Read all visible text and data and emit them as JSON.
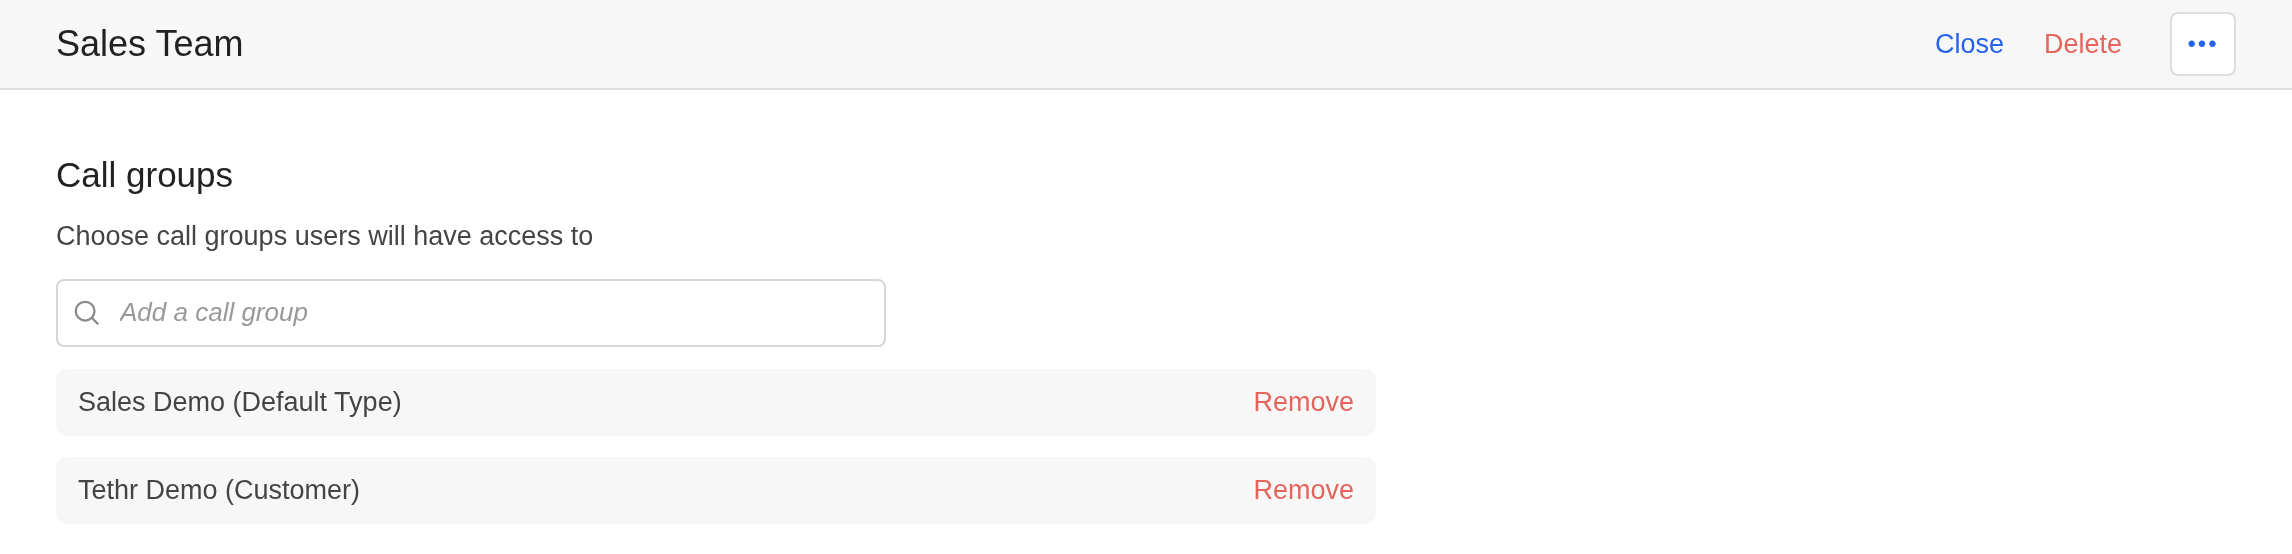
{
  "header": {
    "title": "Sales Team",
    "actions": [
      {
        "label": "Close",
        "kind": "primary"
      },
      {
        "label": "Delete",
        "kind": "danger"
      }
    ],
    "more_button": "•••"
  },
  "section": {
    "title": "Call groups",
    "description": "Choose call groups users will have access to",
    "search": {
      "placeholder": "Add a call group"
    },
    "items": [
      {
        "name": "Sales Demo (Default Type)",
        "action": "Remove"
      },
      {
        "name": "Tethr Demo (Customer)",
        "action": "Remove"
      }
    ]
  }
}
